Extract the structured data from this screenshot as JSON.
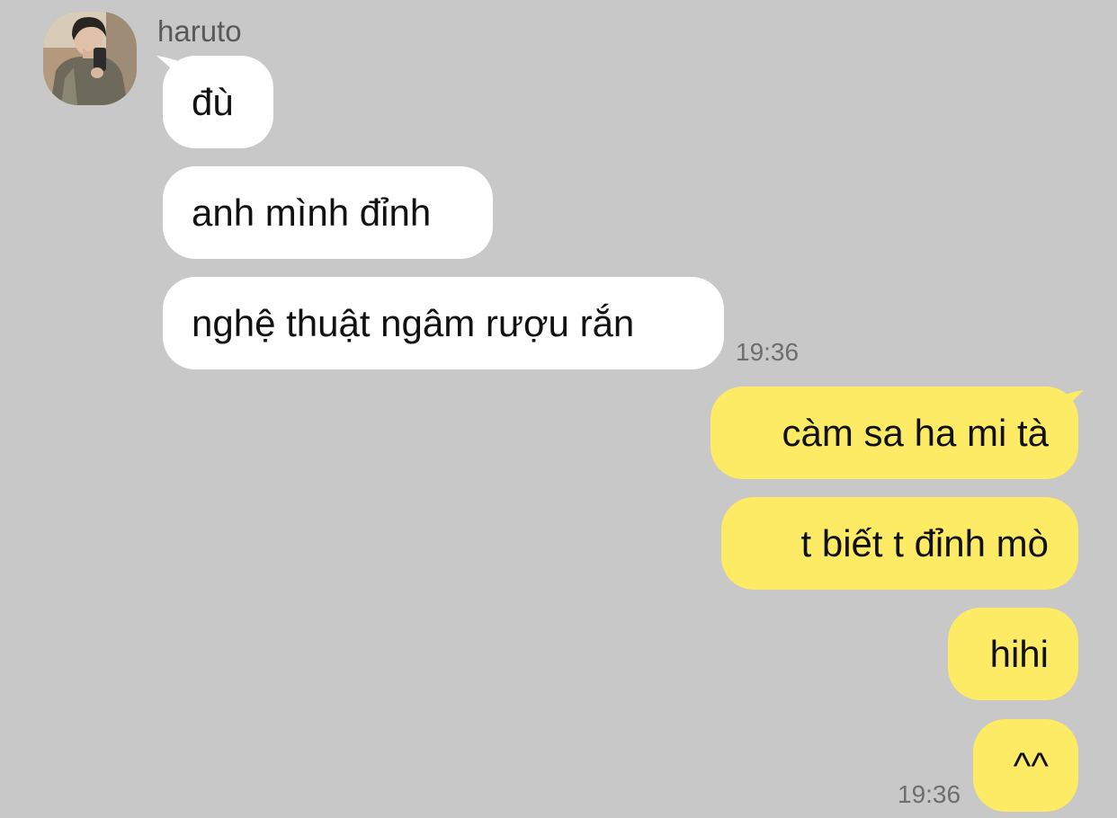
{
  "theme": {
    "background": "#c8c8c8",
    "incoming_bubble": "#ffffff",
    "outgoing_bubble": "#fdea65",
    "timestamp_color": "#6e6e6e",
    "sender_color": "#595959"
  },
  "conversation": {
    "sender": {
      "name": "haruto",
      "avatar_icon": "profile-photo-avatar"
    },
    "incoming": [
      {
        "text": "đù"
      },
      {
        "text": "anh mình đỉnh"
      },
      {
        "text": "nghệ thuật ngâm rượu rắn"
      }
    ],
    "incoming_time": "19:36",
    "outgoing": [
      {
        "text": "càm sa ha mi tà"
      },
      {
        "text": "t biết t đỉnh mò"
      },
      {
        "text": "hihi"
      },
      {
        "text": "^^"
      }
    ],
    "outgoing_time": "19:36"
  }
}
